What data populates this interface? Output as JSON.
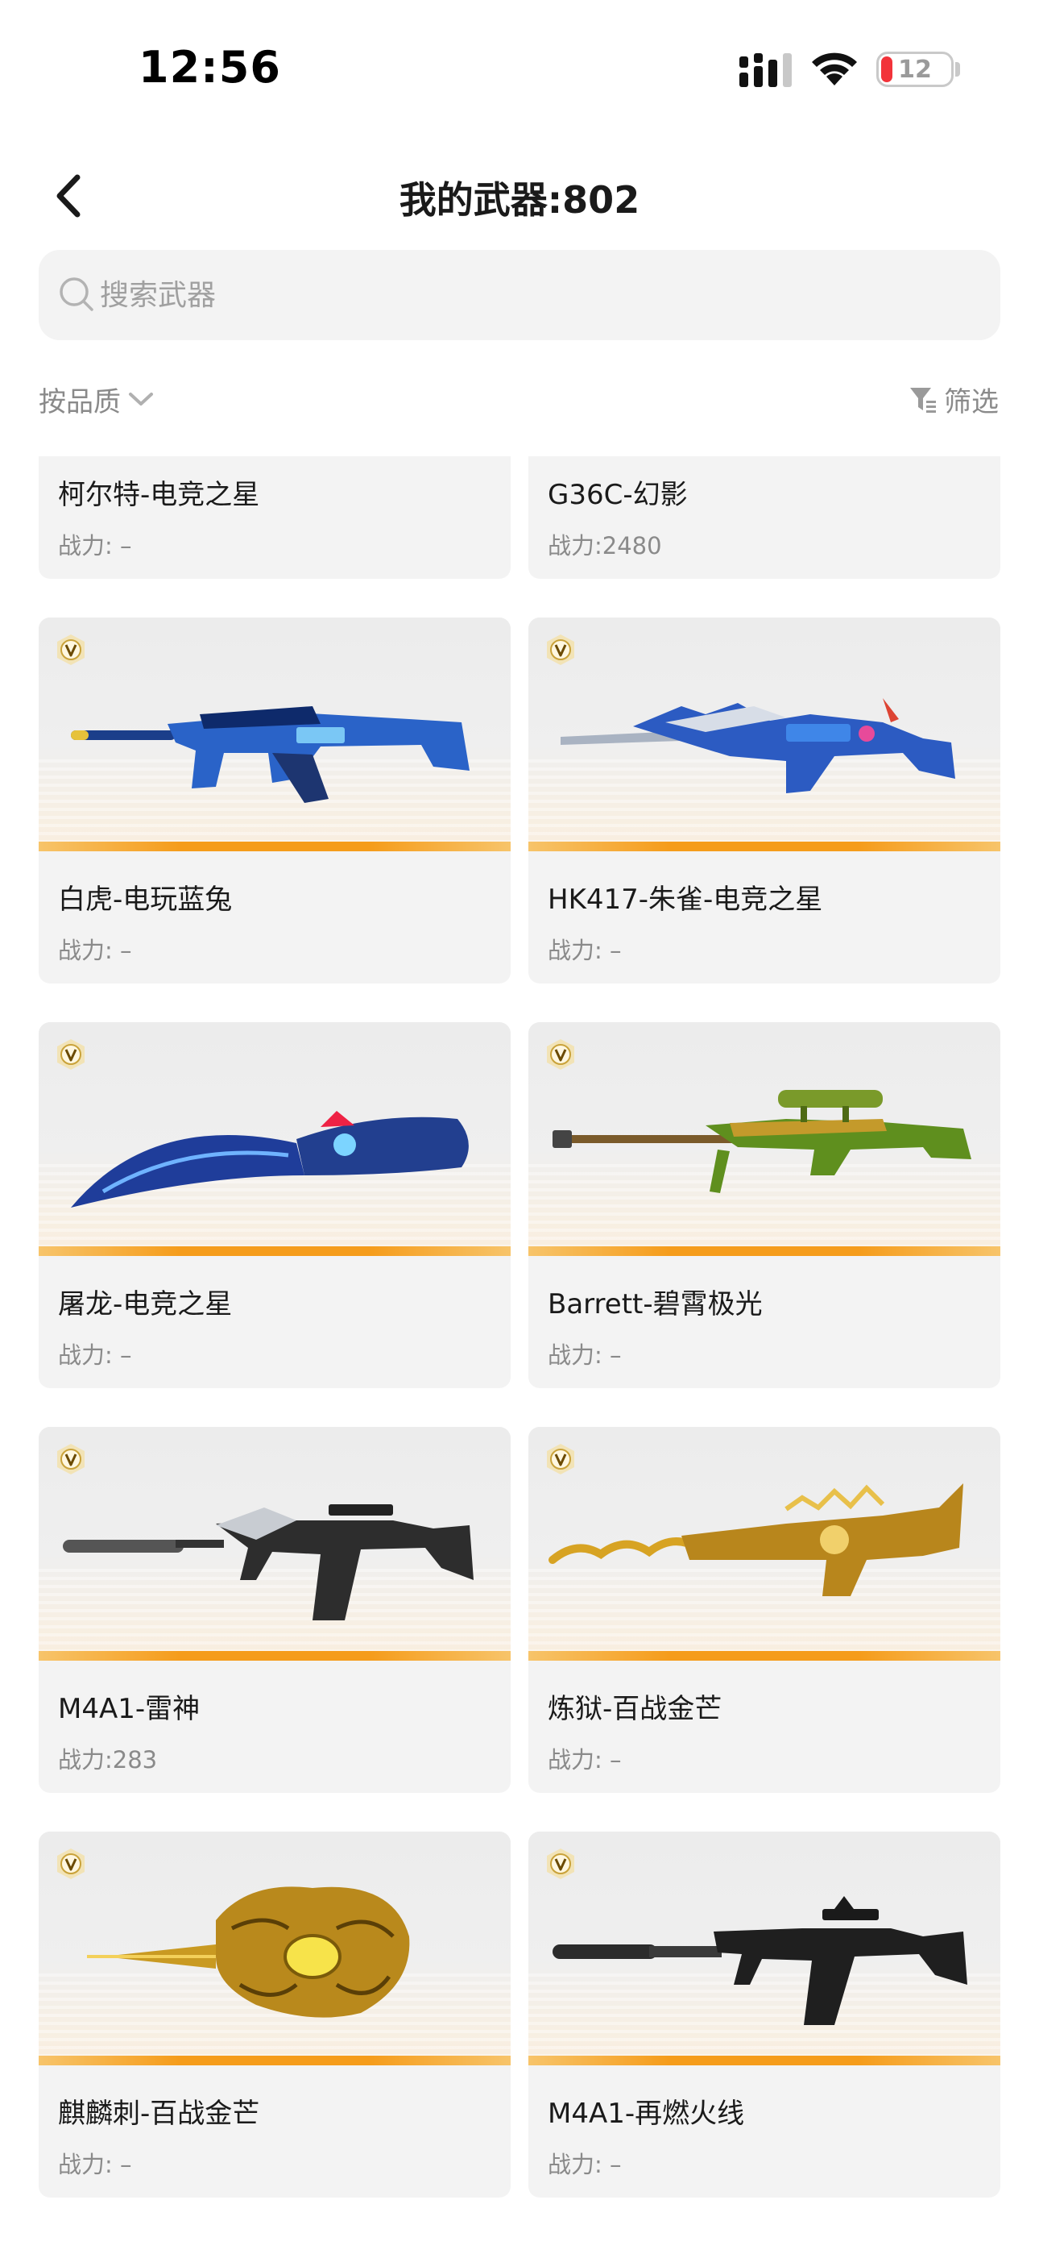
{
  "status_bar": {
    "time": "12:56",
    "battery_level": "12"
  },
  "header": {
    "title": "我的武器:802"
  },
  "search": {
    "placeholder": "搜索武器",
    "value": ""
  },
  "sort": {
    "label": "按品质"
  },
  "filter": {
    "label": "筛选"
  },
  "colors": {
    "accent": "#f59c1b",
    "muted_text": "#8a8a8a",
    "card_bg": "#f3f3f3",
    "battery_low": "#f2333a"
  },
  "weapons": [
    {
      "name": "柯尔特-电竞之星",
      "power": "战力: –",
      "icon": "rifle-icon"
    },
    {
      "name": "G36C-幻影",
      "power": "战力:2480",
      "icon": "rifle-icon"
    },
    {
      "name": "白虎-电玩蓝兔",
      "power": "战力: –",
      "icon": "assault-rifle-blue-icon",
      "vip": true
    },
    {
      "name": "HK417-朱雀-电竞之星",
      "power": "战力: –",
      "icon": "assault-rifle-blue-silver-icon",
      "vip": true
    },
    {
      "name": "屠龙-电竞之星",
      "power": "战力: –",
      "icon": "kukri-knife-icon",
      "vip": true
    },
    {
      "name": "Barrett-碧霄极光",
      "power": "战力: –",
      "icon": "sniper-rifle-green-icon",
      "vip": true
    },
    {
      "name": "M4A1-雷神",
      "power": "战力:283",
      "icon": "m4a1-black-icon",
      "vip": true
    },
    {
      "name": "炼狱-百战金芒",
      "power": "战力: –",
      "icon": "gatling-gold-dragon-icon",
      "vip": true
    },
    {
      "name": "麒麟刺-百战金芒",
      "power": "战力: –",
      "icon": "golden-dagger-icon",
      "vip": true
    },
    {
      "name": "M4A1-再燃火线",
      "power": "战力: –",
      "icon": "m4a1-classic-icon",
      "vip": true
    }
  ]
}
